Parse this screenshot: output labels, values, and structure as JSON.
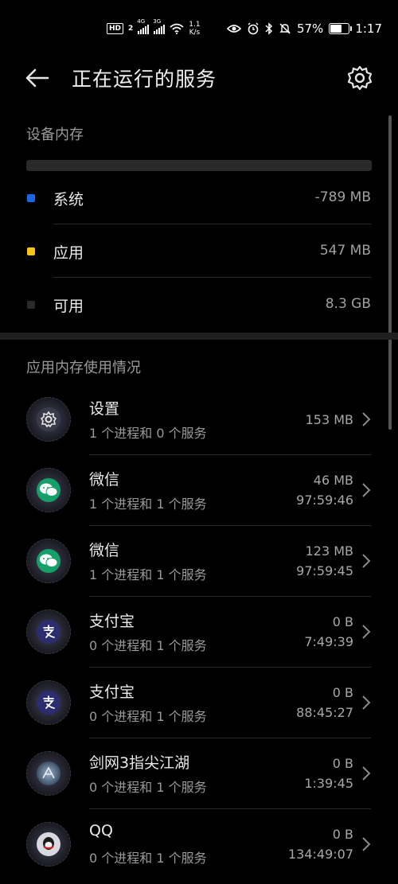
{
  "status_bar": {
    "hd": "HD",
    "hd_sub": "2",
    "signal1_tag": "4G",
    "signal2_tag": "3G",
    "speed_top": "1.1",
    "speed_bottom": "K/s",
    "battery_percent_text": "57%",
    "battery_level": 0.57,
    "time": "1:17"
  },
  "header": {
    "title": "正在运行的服务",
    "back_icon": "arrow-left-icon",
    "settings_icon": "gear-icon"
  },
  "device_memory": {
    "title": "设备内存",
    "rows": [
      {
        "label": "系统",
        "value": "-789 MB",
        "color": "#1a66e6"
      },
      {
        "label": "应用",
        "value": "547 MB",
        "color": "#f5c518"
      },
      {
        "label": "可用",
        "value": "8.3 GB",
        "color": "#2a2a2a"
      }
    ]
  },
  "app_memory": {
    "title": "应用内存使用情况",
    "apps": [
      {
        "name": "设置",
        "sub": "1 个进程和 0 个服务",
        "size": "153 MB",
        "time": "",
        "icon": "settings-icon"
      },
      {
        "name": "微信",
        "sub": "1 个进程和 1 个服务",
        "size": "46 MB",
        "time": "97:59:46",
        "icon": "wechat-icon"
      },
      {
        "name": "微信",
        "sub": "1 个进程和 1 个服务",
        "size": "123 MB",
        "time": "97:59:45",
        "icon": "wechat-icon"
      },
      {
        "name": "支付宝",
        "sub": "0 个进程和 1 个服务",
        "size": "0 B",
        "time": "7:49:39",
        "icon": "alipay-icon"
      },
      {
        "name": "支付宝",
        "sub": "0 个进程和 1 个服务",
        "size": "0 B",
        "time": "88:45:27",
        "icon": "alipay-icon"
      },
      {
        "name": "剑网3指尖江湖",
        "sub": "0 个进程和 1 个服务",
        "size": "0 B",
        "time": "1:39:45",
        "icon": "game-icon"
      },
      {
        "name": "QQ",
        "sub": "0 个进程和 1 个服务",
        "size": "0 B",
        "time": "134:49:07",
        "icon": "qq-icon"
      }
    ]
  }
}
